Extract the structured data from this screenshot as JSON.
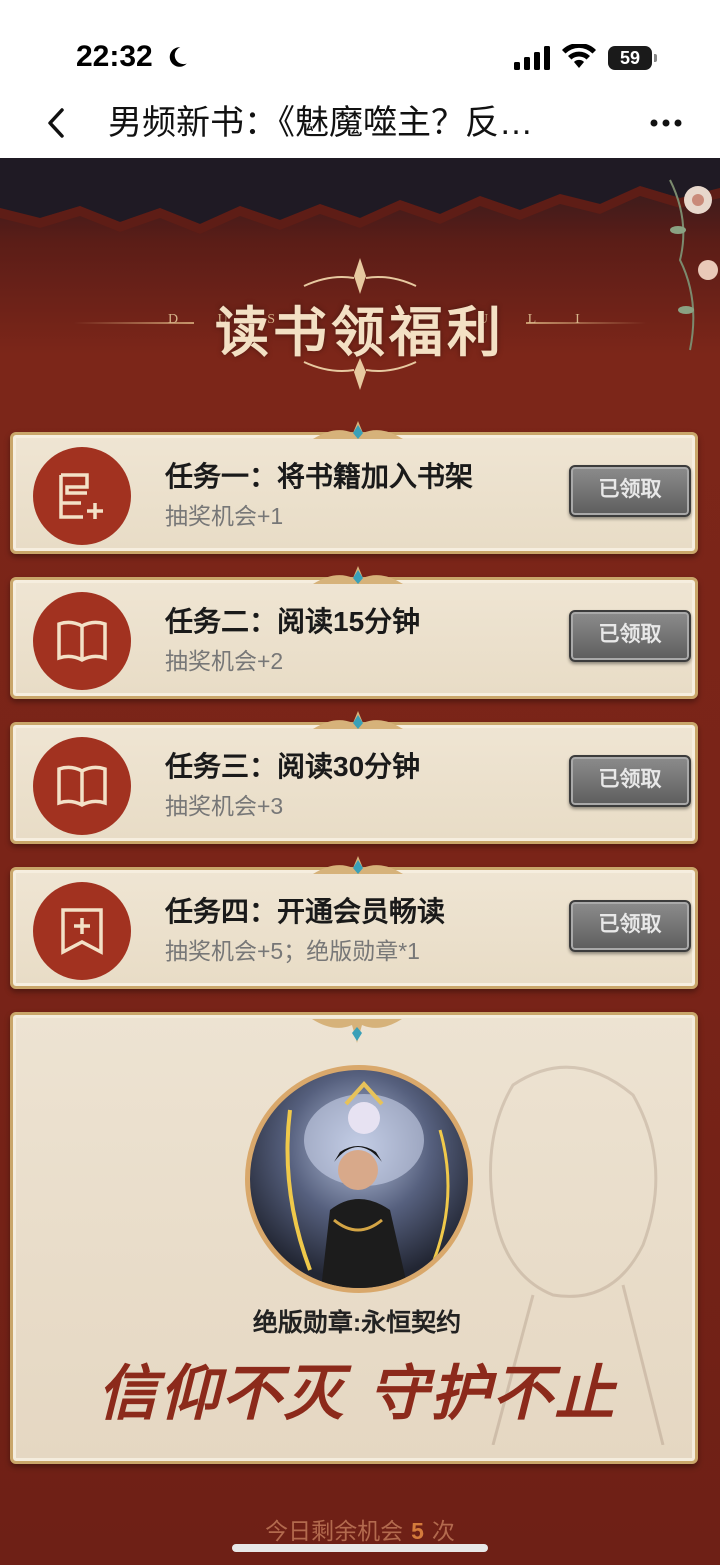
{
  "status_bar": {
    "time": "22:32",
    "battery": "59"
  },
  "nav": {
    "title": "男频新书：《魅魔噬主？反…"
  },
  "header": {
    "title": "读书领福利",
    "left_letters": "D U S",
    "right_letters": "U L I"
  },
  "tasks": [
    {
      "title": "任务一：将书籍加入书架",
      "reward": "抽奖机会+1",
      "button": "已领取",
      "icon": "bookshelf-add-icon"
    },
    {
      "title": "任务二：阅读15分钟",
      "reward": "抽奖机会+2",
      "button": "已领取",
      "icon": "open-book-icon"
    },
    {
      "title": "任务三：阅读30分钟",
      "reward": "抽奖机会+3",
      "button": "已领取",
      "icon": "open-book-icon"
    },
    {
      "title": "任务四：开通会员畅读",
      "reward": "抽奖机会+5；绝版勋章*1",
      "button": "已领取",
      "icon": "bookmark-plus-icon"
    }
  ],
  "medal": {
    "name": "绝版勋章:永恒契约",
    "slogan": "信仰不灭 守护不止"
  },
  "remaining": {
    "prefix": "今日剩余机会",
    "count": "5",
    "suffix": "次"
  },
  "colors": {
    "accent_red": "#a23220",
    "card_bg": "#efe5d3",
    "gold_border": "#c9a66a",
    "page_bg": "#7a2418"
  }
}
